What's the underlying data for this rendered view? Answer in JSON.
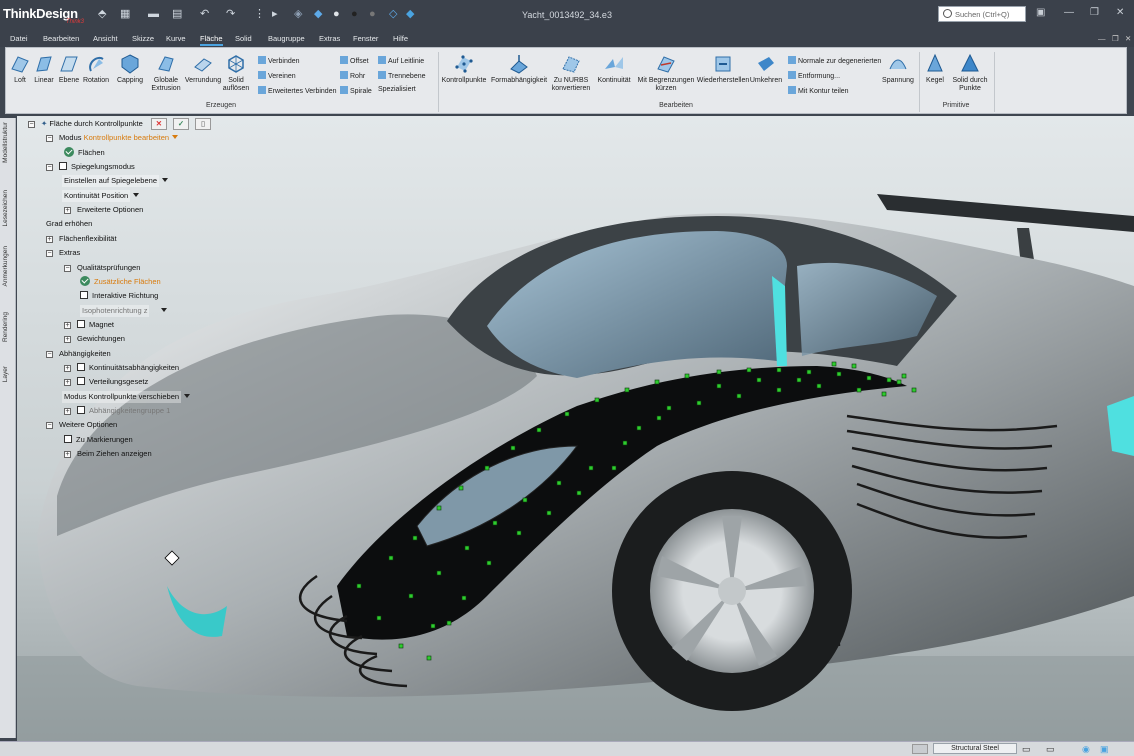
{
  "titlebar": {
    "logo": "ThinkDesign",
    "logo_sub": "Think3",
    "document_title": "Yacht_0013492_34.e3",
    "search_placeholder": "Suchen (Ctrl+Q)"
  },
  "menu": {
    "items": [
      "Datei",
      "Bearbeiten",
      "Ansicht",
      "Skizze",
      "Kurve",
      "Fläche",
      "Solid",
      "Baugruppe",
      "Extras",
      "Fenster",
      "Hilfe"
    ],
    "active": "Fläche"
  },
  "ribbon": {
    "erzeugen": {
      "label": "Erzeugen",
      "buttons": [
        "Loft",
        "Linear",
        "Ebene",
        "Rotation",
        "Capping",
        "Globale Extrusion",
        "Verrundung",
        "Solid auflösen"
      ],
      "small": [
        "Verbinden",
        "Vereinen",
        "Erweitertes Verbinden",
        "Offset",
        "Rohr",
        "Spirale",
        "Auf Leitlinie",
        "Trennebene",
        "Spezialisiert"
      ]
    },
    "bearbeiten": {
      "label": "Bearbeiten",
      "buttons": [
        "Kontrollpunkte",
        "Formabhängigkeit",
        "Zu NURBS konvertieren",
        "Kontinuität",
        "Mit Begrenzungen kürzen",
        "Wiederherstellen",
        "Umkehren"
      ],
      "small": [
        "Normale zur degenerierten",
        "Entformung...",
        "Mit Kontur teilen"
      ],
      "spannung": "Spannung"
    },
    "primitive": {
      "label": "Primitive",
      "buttons": [
        "Kegel",
        "Solid durch Punkte"
      ]
    }
  },
  "side_tabs": [
    "Modellstruktur",
    "Lesezeichen",
    "Anmerkungen",
    "Rendering",
    "Layer"
  ],
  "tree": {
    "root": "Fläche durch Kontrollpunkte",
    "modus_label": "Modus",
    "modus_value": "Kontrollpunkte bearbeiten",
    "flaechen": "Flächen",
    "spiegelungsmodus": "Spiegelungsmodus",
    "einstellen": "Einstellen auf Spiegelebene",
    "kontinuitaet": "Kontinuität Position",
    "erweiterte_optionen": "Erweiterte Optionen",
    "grad_erhoehen": "Grad erhöhen",
    "flaechenflexibilitaet": "Flächenflexibilität",
    "extras": "Extras",
    "qualitaetspruefungen": "Qualitätsprüfungen",
    "zusaetzliche_flaechen": "Zusätzliche Flächen",
    "interaktive_richtung": "Interaktive Richtung",
    "isophotenrichtung": "Isophotenrichtung z",
    "magnet": "Magnet",
    "gewichtungen": "Gewichtungen",
    "abhaengigkeiten": "Abhängigkeiten",
    "kontinuitaetsabhaengigkeiten": "Kontinuitätsabhängigkeiten",
    "verteilungsgesetz": "Verteilungsgesetz",
    "modus2": "Modus Kontrollpunkte verschieben",
    "abhaengigkeitengruppe": "Abhängigkeitengruppe 1",
    "weitere_optionen": "Weitere Optionen",
    "zu_markierungen": "Zu Markierungen",
    "beim_ziehen": "Beim Ziehen anzeigen"
  },
  "status": {
    "material": "Structural Steel"
  },
  "colors": {
    "titlebar": "#3b414b",
    "ribbon": "#e7e9ec",
    "accent": "#4aa3e0",
    "highlight_text": "#d87b0d",
    "control_point": "#2ecc2e"
  }
}
